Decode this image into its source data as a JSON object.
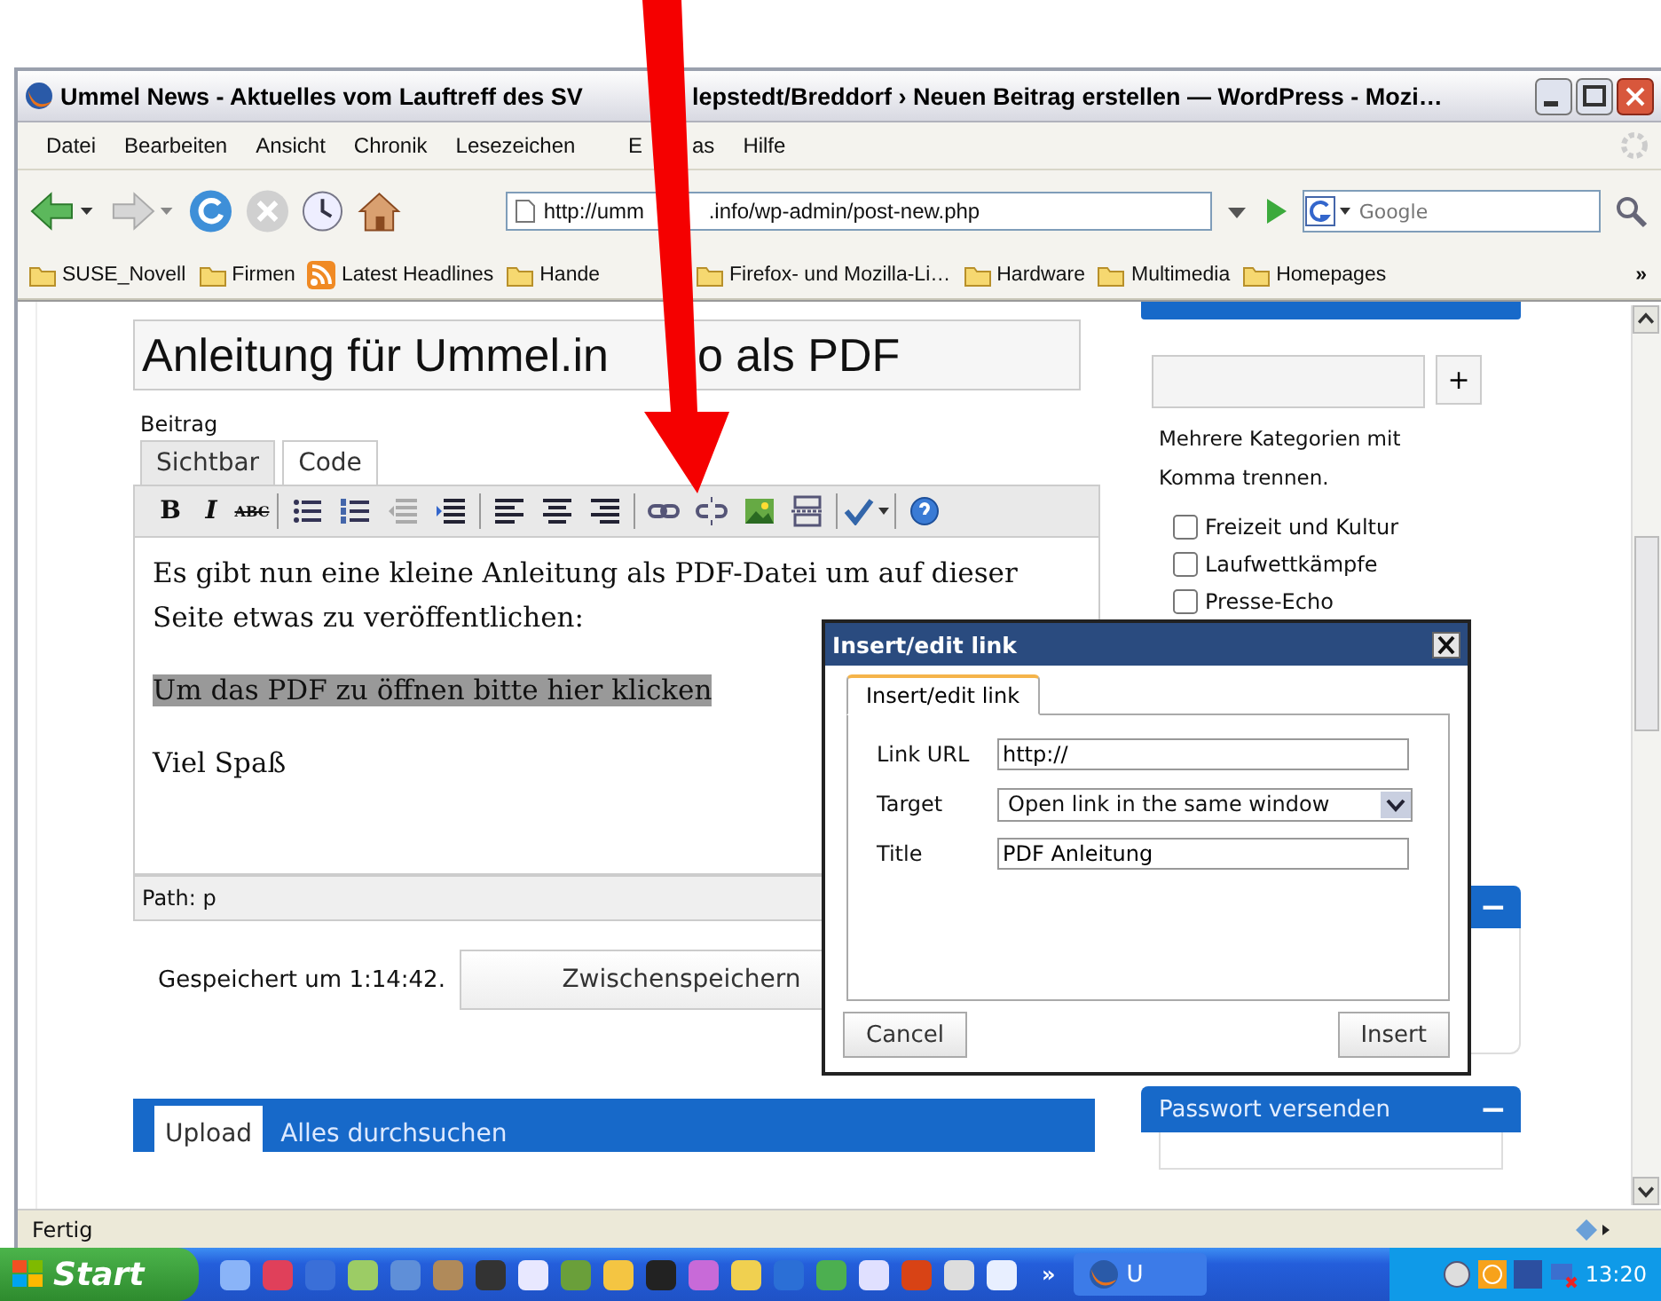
{
  "window": {
    "title_before": "Ummel News - Aktuelles vom Lauftreff des SV",
    "title_after": "lepstedt/Breddorf › Neuen Beitrag erstellen — WordPress - Mozi…"
  },
  "menu": [
    {
      "label": "Datei"
    },
    {
      "label": "Bearbeiten"
    },
    {
      "label": "Ansicht"
    },
    {
      "label": "Chronik"
    },
    {
      "label": "Lesezeichen"
    },
    {
      "label": "E",
      "label_after": "as"
    },
    {
      "label": "Hilfe"
    }
  ],
  "address": {
    "value_before": "http://umm",
    "value_after": ".info/wp-admin/post-new.php"
  },
  "search": {
    "placeholder": "Google"
  },
  "bookmarks": [
    {
      "label": "SUSE_Novell",
      "kind": "folder"
    },
    {
      "label": "Firmen",
      "kind": "folder"
    },
    {
      "label": "Latest Headlines",
      "kind": "feed"
    },
    {
      "label": "Hande",
      "kind": "folder"
    },
    {
      "label": "Firefox- und Mozilla-Li…",
      "kind": "folder"
    },
    {
      "label": "Hardware",
      "kind": "folder"
    },
    {
      "label": "Multimedia",
      "kind": "folder"
    },
    {
      "label": "Homepages",
      "kind": "folder"
    }
  ],
  "bookmarks_more": "»",
  "post": {
    "title_before": "Anleitung für Ummel.in",
    "title_after": "o als PDF",
    "section_label": "Beitrag",
    "tabs": [
      {
        "label": "Sichtbar",
        "selected": true
      },
      {
        "label": "Code",
        "selected": false
      }
    ],
    "toolbar": [
      {
        "kind": "bold",
        "label": "B"
      },
      {
        "kind": "italic",
        "label": "I"
      },
      {
        "kind": "strike",
        "label": "ABC"
      },
      {
        "kind": "sep"
      },
      {
        "kind": "bullets"
      },
      {
        "kind": "numbers"
      },
      {
        "kind": "outdent"
      },
      {
        "kind": "indent"
      },
      {
        "kind": "sep"
      },
      {
        "kind": "align-left"
      },
      {
        "kind": "align-center"
      },
      {
        "kind": "align-right"
      },
      {
        "kind": "sep"
      },
      {
        "kind": "link"
      },
      {
        "kind": "unlink"
      },
      {
        "kind": "image"
      },
      {
        "kind": "more"
      },
      {
        "kind": "sep"
      },
      {
        "kind": "spell"
      },
      {
        "kind": "sep"
      },
      {
        "kind": "help"
      }
    ],
    "paragraphs": [
      {
        "text": "Es gibt nun eine kleine Anleitung als PDF-Datei um auf dieser Seite etwas zu veröffentlichen:",
        "highlighted": false
      },
      {
        "text": "Um das PDF zu öffnen bitte hier klicken",
        "highlighted": true
      },
      {
        "text": "Viel Spaß",
        "highlighted": false
      }
    ],
    "path": "Path: p",
    "saved": "Gespeichert um 1:14:42.",
    "save_button": "Zwischenspeichern"
  },
  "media_tabs": [
    {
      "label": "Upload",
      "selected": true
    },
    {
      "label": "Alles durchsuchen",
      "selected": false
    }
  ],
  "categories": {
    "add_button": "+",
    "hint": "Mehrere Kategorien mit Komma trennen.",
    "items": [
      {
        "label": "Freizeit und Kultur",
        "checked": false
      },
      {
        "label": "Laufwettkämpfe",
        "checked": false
      },
      {
        "label": "Presse-Echo",
        "checked": false
      }
    ]
  },
  "box_toggle": "−",
  "password_box": {
    "title": "Passwort versenden",
    "toggle": "−"
  },
  "dialog": {
    "title": "Insert/edit link",
    "tab": "Insert/edit link",
    "fields": [
      {
        "label": "Link URL",
        "kind": "text",
        "value": "http://"
      },
      {
        "label": "Target",
        "kind": "select",
        "value": "Open link in the same window"
      },
      {
        "label": "Title",
        "kind": "text",
        "value": "PDF Anleitung"
      }
    ],
    "cancel": "Cancel",
    "insert": "Insert"
  },
  "status_bar": {
    "text": "Fertig"
  },
  "taskbar": {
    "start": "Start",
    "more": "»",
    "task": "U",
    "clock": "13:20"
  }
}
